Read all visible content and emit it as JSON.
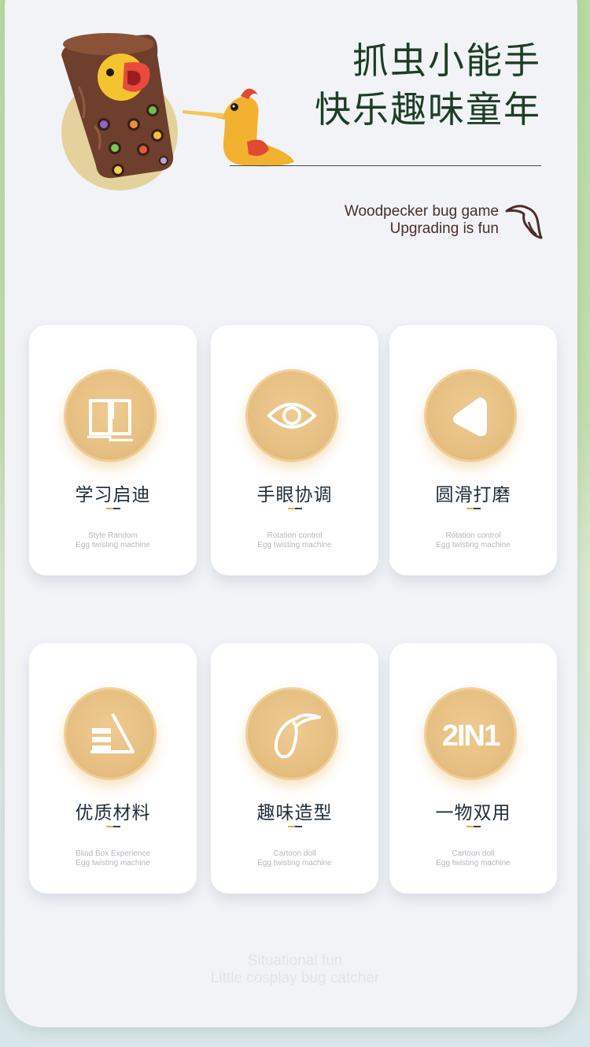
{
  "header": {
    "title_line1": "抓虫小能手",
    "title_line2": "快乐趣味童年",
    "subtitle_line1": "Woodpecker bug game",
    "subtitle_line2": "Upgrading is fun"
  },
  "cards": [
    {
      "title": "学习启迪",
      "sub1": "Style Random",
      "sub2": "Egg twisting machine",
      "icon": "book-icon"
    },
    {
      "title": "手眼协调",
      "sub1": "Rotation control",
      "sub2": "Egg twisting machine",
      "icon": "eye-icon"
    },
    {
      "title": "圆滑打磨",
      "sub1": "Rotation control",
      "sub2": "Egg twisting machine",
      "icon": "rounded-triangle-icon"
    },
    {
      "title": "优质材料",
      "sub1": "Blind Box Experience",
      "sub2": "Egg twisting machine",
      "icon": "layers-icon"
    },
    {
      "title": "趣味造型",
      "sub1": "Cartoon doll",
      "sub2": "Egg twisting machine",
      "icon": "bird-icon",
      "badge_text": ""
    },
    {
      "title": "一物双用",
      "sub1": "Cartoon doll",
      "sub2": "Egg twisting machine",
      "icon": "2in1-icon",
      "badge_text": "2IN1"
    }
  ],
  "footer": {
    "line1": "Situational fun",
    "line2": "Little cosplay bug catcher"
  },
  "colors": {
    "accent_gold": "#e6bf82",
    "title_green": "#1d3d24",
    "dash_orange": "#e8a93a",
    "dash_navy": "#2f4156"
  }
}
